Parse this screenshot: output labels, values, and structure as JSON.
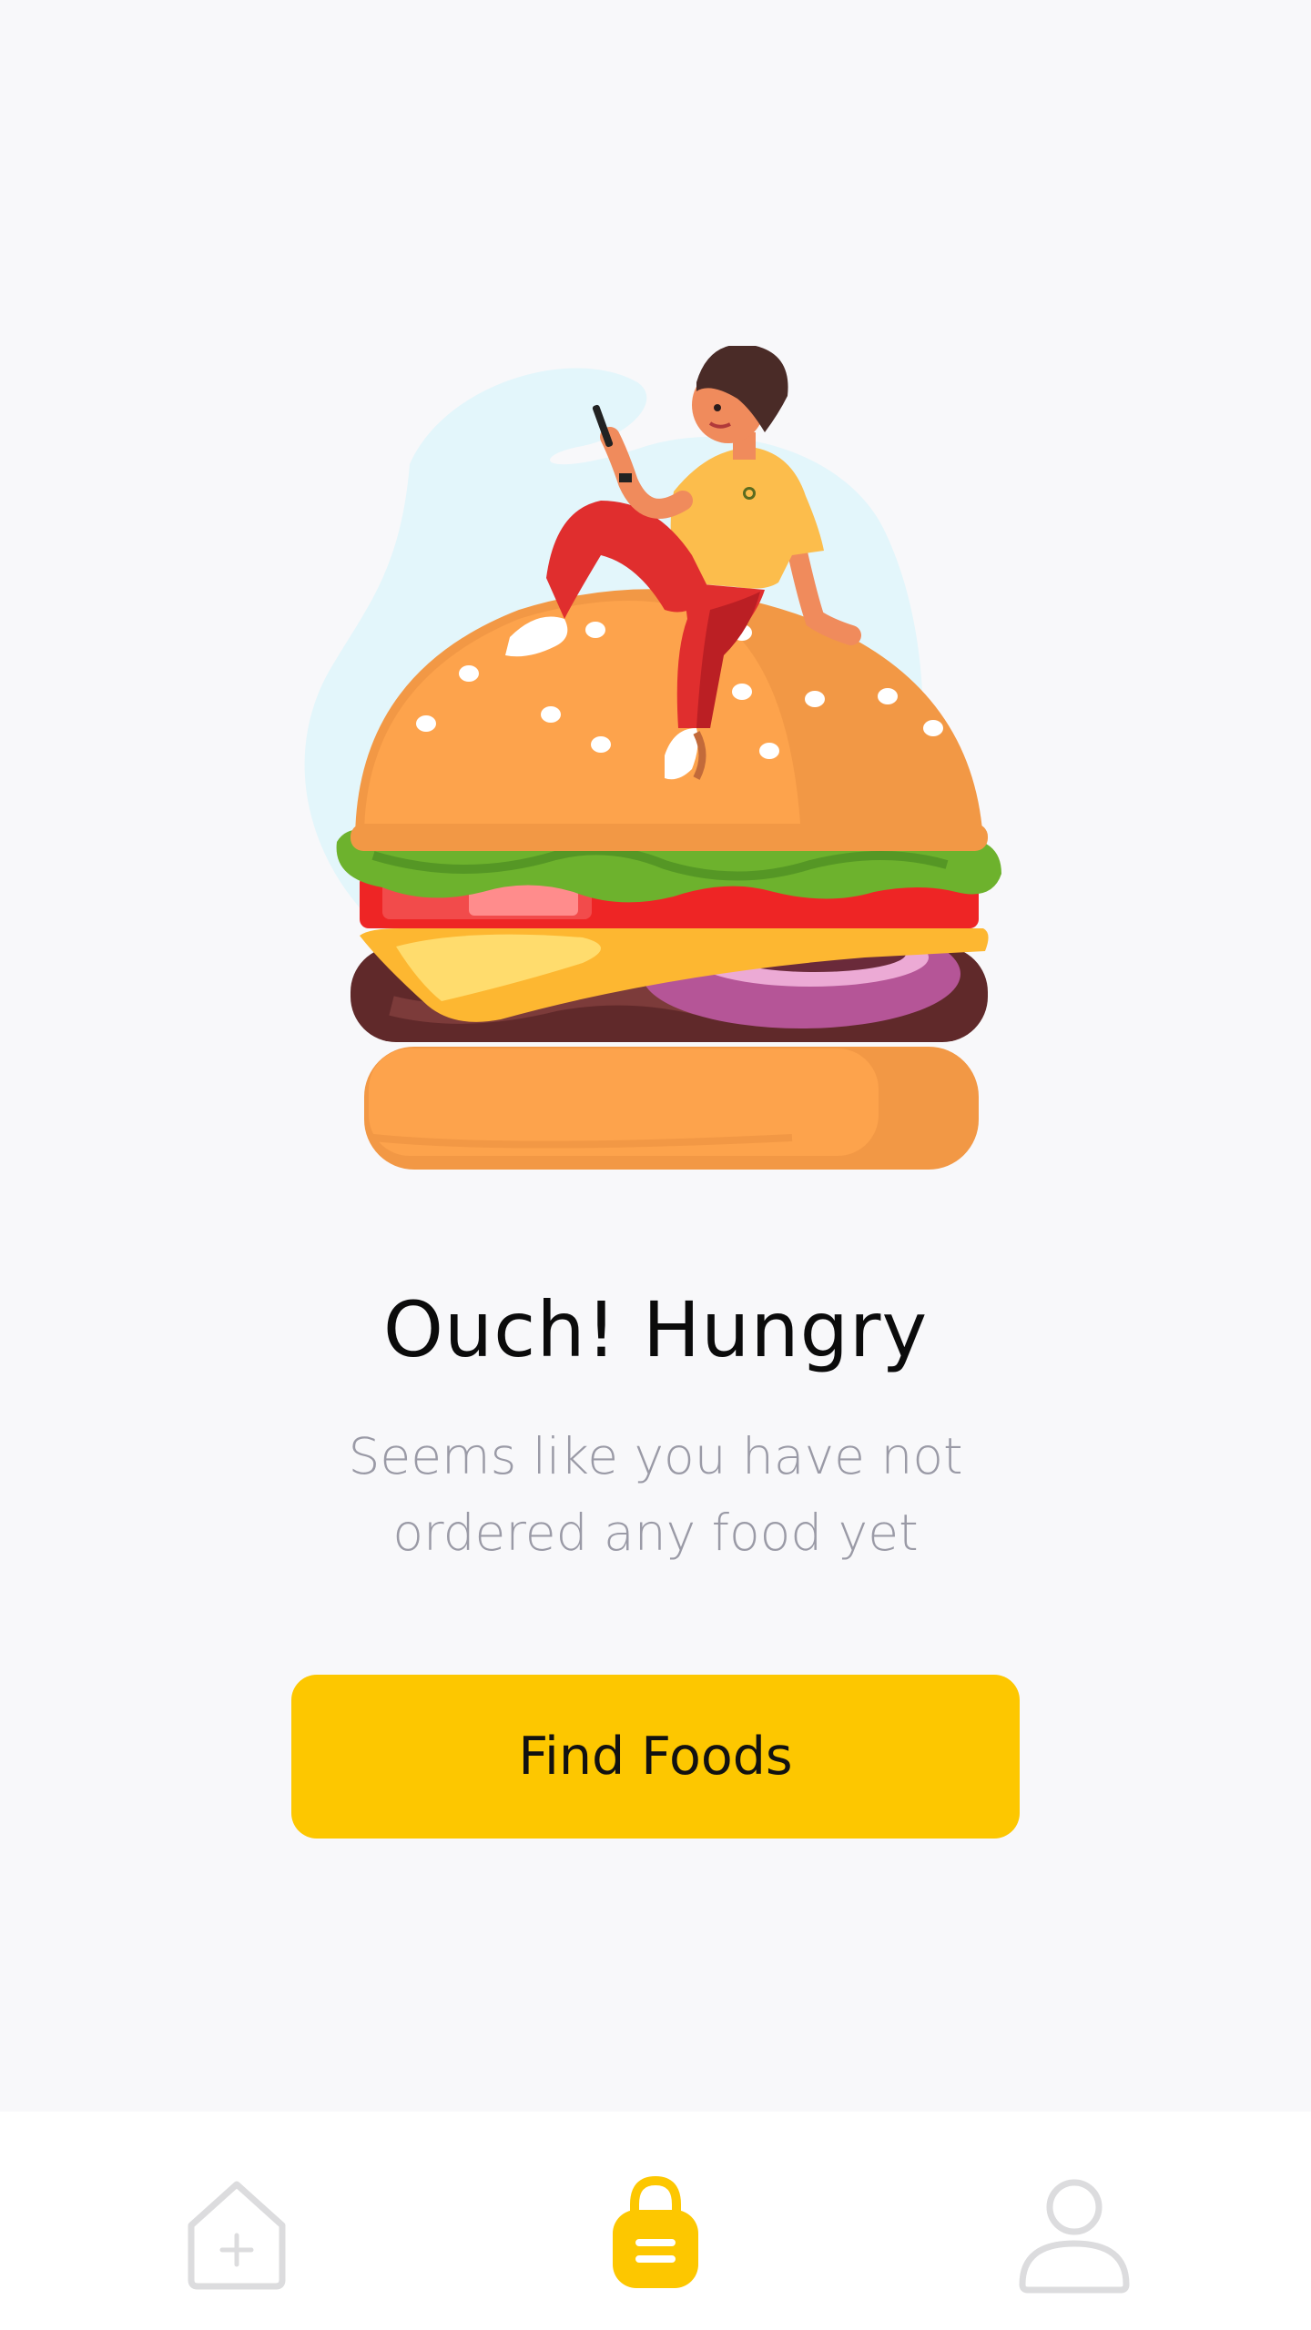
{
  "empty_state": {
    "title": "Ouch! Hungry",
    "subtitle": "Seems like you have not ordered any food yet",
    "cta_label": "Find Foods"
  },
  "nav": {
    "items": [
      {
        "icon": "home-add-icon",
        "active": false
      },
      {
        "icon": "shopping-bag-icon",
        "active": true
      },
      {
        "icon": "user-icon",
        "active": false
      }
    ]
  },
  "colors": {
    "background": "#f8f8fa",
    "accent": "#fdc700",
    "text_primary": "#0b0b0b",
    "text_secondary": "#9a9aa6",
    "nav_inactive": "#dcdcde"
  }
}
